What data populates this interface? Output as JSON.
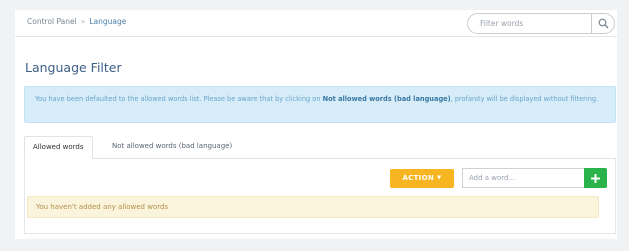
{
  "breadcrumb": {
    "root": "Control Panel",
    "separator": "»",
    "current": "Language"
  },
  "search": {
    "placeholder": "Filter words",
    "button_icon": "search-icon"
  },
  "page": {
    "title": "Language Filter"
  },
  "info": {
    "text_before": "You have been defaulted to the allowed words list. Please be aware that by clicking on ",
    "bold": "Not allowed words (bad language)",
    "text_after": ", profanity will be displayed without filtering."
  },
  "tabs": [
    {
      "label": "Allowed words",
      "active": true
    },
    {
      "label": "Not allowed words (bad language)",
      "active": false
    }
  ],
  "toolbar": {
    "action_label": "ACTION",
    "action_icon": "caret-down-icon",
    "add_placeholder": "Add a word...",
    "add_icon": "plus-icon"
  },
  "empty_message": "You haven't added any allowed words",
  "colors": {
    "accent": "#3b5f87",
    "info_bg": "#d6ecf8",
    "action": "#f6b521",
    "add": "#29b34a",
    "warning_bg": "#fbf4dc"
  }
}
